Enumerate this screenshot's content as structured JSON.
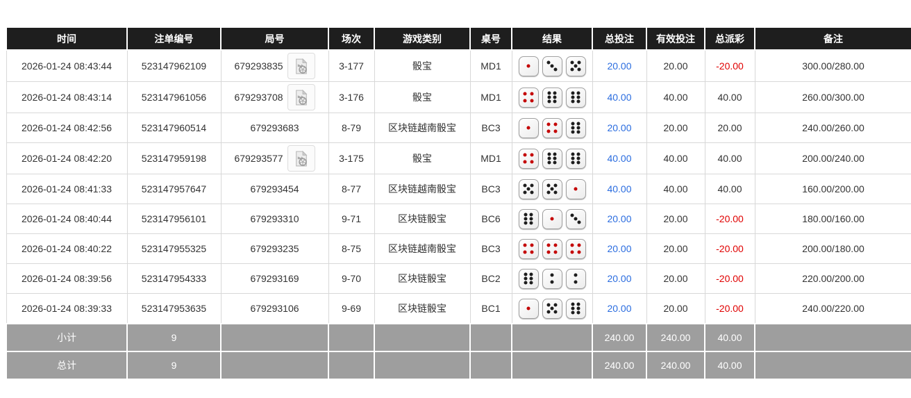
{
  "colors": {
    "header_bg": "#1e1e1e",
    "footer_bg": "#9e9e9e",
    "bet_blue": "#2a6cdf",
    "negative_red": "#e00000"
  },
  "table": {
    "headers": [
      "时间",
      "注单编号",
      "局号",
      "场次",
      "游戏类别",
      "桌号",
      "结果",
      "总投注",
      "有效投注",
      "总派彩",
      "备注"
    ],
    "rows": [
      {
        "time": "2026-01-24 08:43:44",
        "bet_id": "523147962109",
        "round": "679293835",
        "has_video": true,
        "session": "3-177",
        "game": "骰宝",
        "table_no": "MD1",
        "dice": [
          1,
          3,
          5
        ],
        "total_bet": "20.00",
        "valid_bet": "20.00",
        "payout": "-20.00",
        "remark": "300.00/280.00"
      },
      {
        "time": "2026-01-24 08:43:14",
        "bet_id": "523147961056",
        "round": "679293708",
        "has_video": true,
        "session": "3-176",
        "game": "骰宝",
        "table_no": "MD1",
        "dice": [
          4,
          6,
          6
        ],
        "total_bet": "40.00",
        "valid_bet": "40.00",
        "payout": "40.00",
        "remark": "260.00/300.00"
      },
      {
        "time": "2026-01-24 08:42:56",
        "bet_id": "523147960514",
        "round": "679293683",
        "has_video": false,
        "session": "8-79",
        "game": "区块链越南骰宝",
        "table_no": "BC3",
        "dice": [
          1,
          4,
          6
        ],
        "total_bet": "20.00",
        "valid_bet": "20.00",
        "payout": "20.00",
        "remark": "240.00/260.00"
      },
      {
        "time": "2026-01-24 08:42:20",
        "bet_id": "523147959198",
        "round": "679293577",
        "has_video": true,
        "session": "3-175",
        "game": "骰宝",
        "table_no": "MD1",
        "dice": [
          4,
          6,
          6
        ],
        "total_bet": "40.00",
        "valid_bet": "40.00",
        "payout": "40.00",
        "remark": "200.00/240.00"
      },
      {
        "time": "2026-01-24 08:41:33",
        "bet_id": "523147957647",
        "round": "679293454",
        "has_video": false,
        "session": "8-77",
        "game": "区块链越南骰宝",
        "table_no": "BC3",
        "dice": [
          5,
          5,
          1
        ],
        "total_bet": "40.00",
        "valid_bet": "40.00",
        "payout": "40.00",
        "remark": "160.00/200.00"
      },
      {
        "time": "2026-01-24 08:40:44",
        "bet_id": "523147956101",
        "round": "679293310",
        "has_video": false,
        "session": "9-71",
        "game": "区块链骰宝",
        "table_no": "BC6",
        "dice": [
          6,
          1,
          3
        ],
        "total_bet": "20.00",
        "valid_bet": "20.00",
        "payout": "-20.00",
        "remark": "180.00/160.00"
      },
      {
        "time": "2026-01-24 08:40:22",
        "bet_id": "523147955325",
        "round": "679293235",
        "has_video": false,
        "session": "8-75",
        "game": "区块链越南骰宝",
        "table_no": "BC3",
        "dice": [
          4,
          4,
          4
        ],
        "total_bet": "20.00",
        "valid_bet": "20.00",
        "payout": "-20.00",
        "remark": "200.00/180.00"
      },
      {
        "time": "2026-01-24 08:39:56",
        "bet_id": "523147954333",
        "round": "679293169",
        "has_video": false,
        "session": "9-70",
        "game": "区块链骰宝",
        "table_no": "BC2",
        "dice": [
          6,
          2,
          2
        ],
        "total_bet": "20.00",
        "valid_bet": "20.00",
        "payout": "-20.00",
        "remark": "220.00/200.00"
      },
      {
        "time": "2026-01-24 08:39:33",
        "bet_id": "523147953635",
        "round": "679293106",
        "has_video": false,
        "session": "9-69",
        "game": "区块链骰宝",
        "table_no": "BC1",
        "dice": [
          1,
          5,
          6
        ],
        "total_bet": "20.00",
        "valid_bet": "20.00",
        "payout": "-20.00",
        "remark": "240.00/220.00"
      }
    ],
    "subtotal": {
      "label": "小计",
      "count": "9",
      "total_bet": "240.00",
      "valid_bet": "240.00",
      "payout": "40.00"
    },
    "total": {
      "label": "总计",
      "count": "9",
      "total_bet": "240.00",
      "valid_bet": "240.00",
      "payout": "40.00"
    }
  }
}
